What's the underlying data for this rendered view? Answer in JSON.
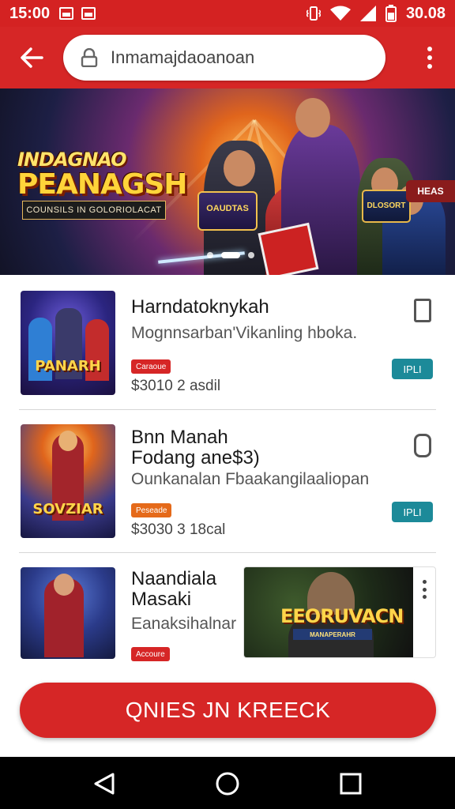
{
  "status_bar": {
    "time": "15:00",
    "battery_text": "30.08"
  },
  "app_bar": {
    "search": {
      "placeholder": "Inmamajdaoanoan"
    }
  },
  "banner": {
    "title_top": "INDAGNAO",
    "title_main": "PEANAGSH",
    "subtitle": "COUNSILS IN GOLORIOLACAT",
    "badge_left": "OAUDTAS",
    "badge_right": "DLOSORT",
    "corner_tag": "HEAS",
    "carousel": {
      "count": 4,
      "active": 2
    }
  },
  "list": {
    "items": [
      {
        "title": "Harndatoknykah",
        "description": "Mognnsarban'Vikanling hboka.",
        "tag": "Caraoue",
        "price": "$3010 2 asdil",
        "thumb_label": "PANARH",
        "save_label": "IPLI"
      },
      {
        "title": "Bnn Manah\nFodang ane$3)",
        "description": "Ounkanalan Fbaakangilaaliopan",
        "tag": "Peseade",
        "price": "$3030 3 18cal",
        "thumb_label": "SOVZIAR",
        "save_label": "IPLI"
      },
      {
        "title": "Naandiala\nMasaki",
        "description": "Eanaksihalnar",
        "tag": "Accoure",
        "price": "",
        "thumb_label": ""
      }
    ],
    "ad": {
      "title": "EEORUVACN",
      "subtitle": "MANAPERAHR"
    }
  },
  "cta": {
    "label": "QNIES JN KREECK"
  },
  "colors": {
    "brand_red": "#d62626",
    "teal": "#1c8a99"
  },
  "icons": [
    "back-arrow-icon",
    "lock-icon",
    "overflow-menu-icon",
    "bookmark-icon",
    "nav-back-icon",
    "nav-home-icon",
    "nav-recents-icon"
  ]
}
